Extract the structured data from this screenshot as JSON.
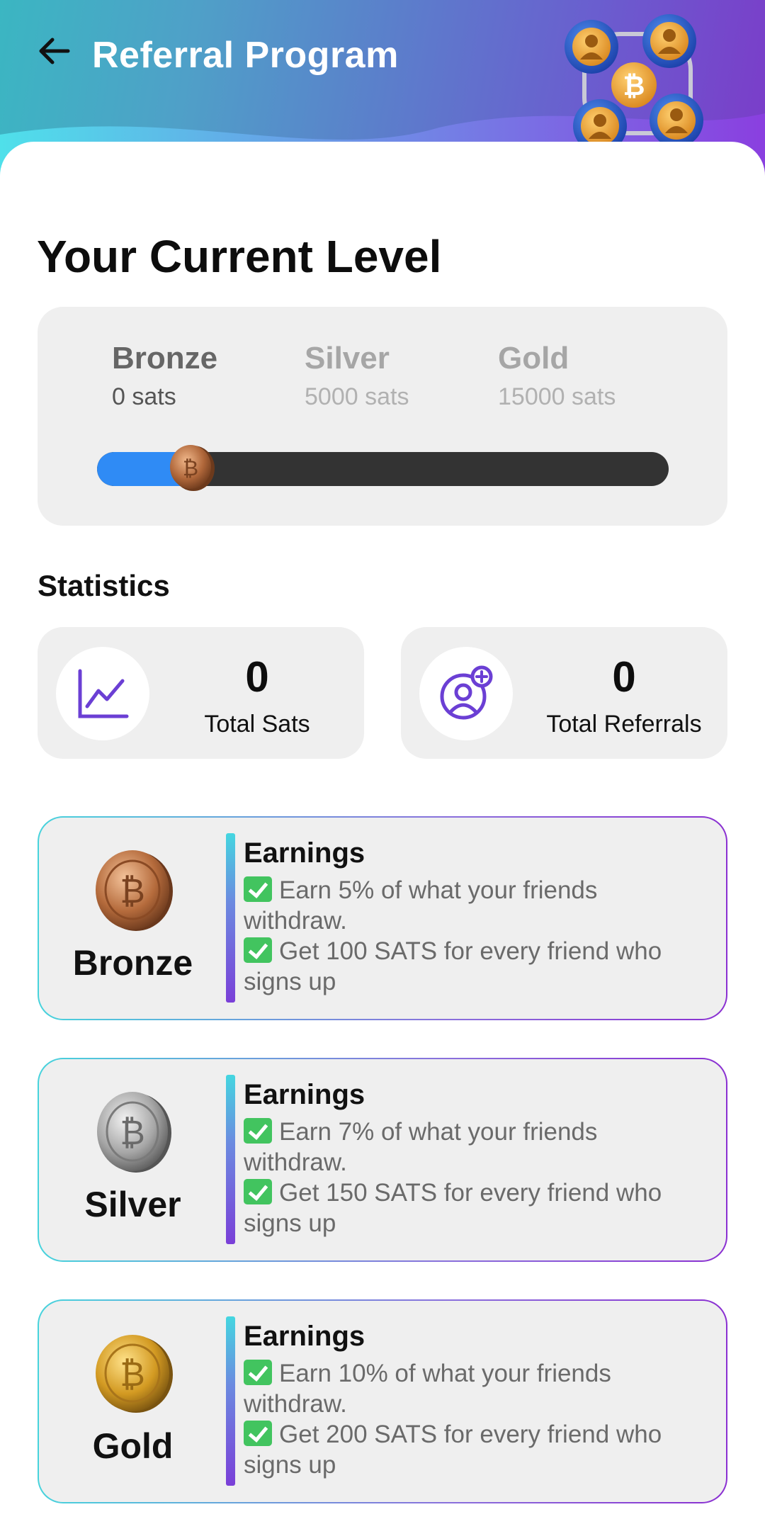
{
  "header": {
    "title": "Referral Program"
  },
  "level_section": {
    "heading": "Your Current Level",
    "levels": [
      {
        "name": "Bronze",
        "sats": "0 sats"
      },
      {
        "name": "Silver",
        "sats": "5000 sats"
      },
      {
        "name": "Gold",
        "sats": "15000 sats"
      }
    ],
    "progress_fraction": 0.17
  },
  "statistics": {
    "heading": "Statistics",
    "total_sats": {
      "value": "0",
      "label": "Total Sats"
    },
    "total_referrals": {
      "value": "0",
      "label": "Total Referrals"
    }
  },
  "tiers": [
    {
      "name": "Bronze",
      "earnings_label": "Earnings",
      "line1": "Earn 5% of what your friends withdraw.",
      "line2": "Get 100 SATS for every friend who signs up"
    },
    {
      "name": "Silver",
      "earnings_label": "Earnings",
      "line1": "Earn 7% of what your friends withdraw.",
      "line2": "Get 150 SATS for every friend who signs up"
    },
    {
      "name": "Gold",
      "earnings_label": "Earnings",
      "line1": "Earn 10% of what your friends withdraw.",
      "line2": "Get 200 SATS for every friend who signs up"
    }
  ],
  "colors": {
    "accent_purple": "#6b3fd4",
    "progress_blue": "#2f8bf5",
    "check_green": "#42c45f"
  },
  "icons": {
    "back": "arrow-left-icon",
    "chart": "line-chart-icon",
    "referral": "user-add-icon",
    "coin": "bitcoin-coin-icon"
  }
}
